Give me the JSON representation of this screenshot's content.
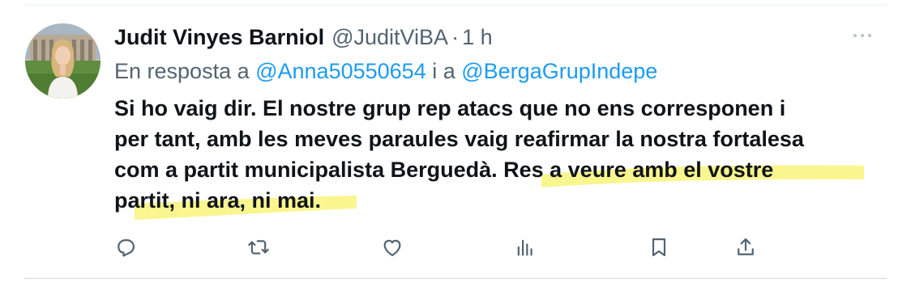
{
  "tweet": {
    "author_name": "Judit Vinyes Barniol",
    "handle": "@JuditViBA",
    "separator": "·",
    "time": "1 h",
    "reply_prefix": "En resposta a ",
    "reply_mention_1": "@Anna50550654",
    "reply_joiner": " i a ",
    "reply_mention_2": "@BergaGrupIndepe",
    "text_line_1": "Si ho vaig dir. El nostre grup rep atacs que no ens corresponen i",
    "text_line_2": "per tant, amb les meves paraules vaig reafirmar la nostra fortalesa",
    "text_line_3": "com a partit municipalista Berguedà. Res a veure amb el vostre",
    "text_line_4": "partit, ni ara, ni mai."
  },
  "icons": {
    "more": "more-horizontal-icon",
    "reply": "reply-icon",
    "retweet": "retweet-icon",
    "like": "heart-icon",
    "views": "views-icon",
    "bookmark": "bookmark-icon",
    "share": "share-icon"
  },
  "colors": {
    "accent": "#1d9bf0",
    "secondary_text": "#536471",
    "primary_text": "#0f1419",
    "highlight": "#f5f26a"
  }
}
